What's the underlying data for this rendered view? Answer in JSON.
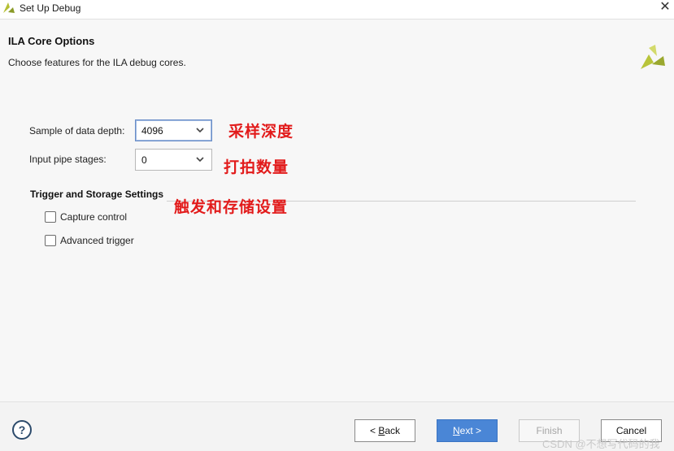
{
  "window": {
    "title": "Set Up Debug",
    "close_glyph": "✕"
  },
  "header": {
    "heading": "ILA Core Options",
    "subheading": "Choose features for the ILA debug cores."
  },
  "options": {
    "sample_depth": {
      "label": "Sample of data depth:",
      "value": "4096"
    },
    "pipe_stages": {
      "label": "Input pipe stages:",
      "value": "0"
    }
  },
  "annotations": {
    "sample_depth_note": "采样深度",
    "pipe_stages_note": "打拍数量",
    "trigger_note": "触发和存储设置"
  },
  "trigger_section": {
    "title": "Trigger and Storage Settings",
    "items": [
      {
        "label": "Capture control",
        "checked": false
      },
      {
        "label": "Advanced trigger",
        "checked": false
      }
    ]
  },
  "footer": {
    "help": "?",
    "back_label": "< ",
    "back_key": "B",
    "back_rest": "ack",
    "next_key": "N",
    "next_rest": "ext >",
    "finish_label": "Finish",
    "cancel_label": "Cancel"
  },
  "watermark": "CSDN @不想写代码的我",
  "colors": {
    "accent": "#4a86d6",
    "annotation": "#e21b1b",
    "logo_yellow": "#b8c43a"
  }
}
